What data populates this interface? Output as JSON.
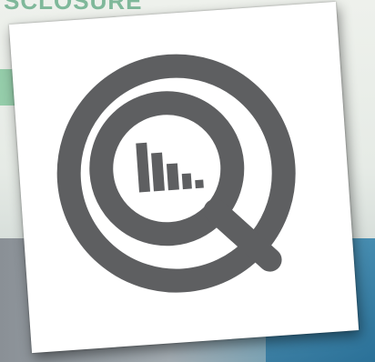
{
  "background": {
    "header_text": "SCLOSURE",
    "accent_color": "#7fb89a"
  },
  "card": {
    "icon": "magnifier-bar-chart-icon",
    "icon_color": "#5e5f61"
  }
}
